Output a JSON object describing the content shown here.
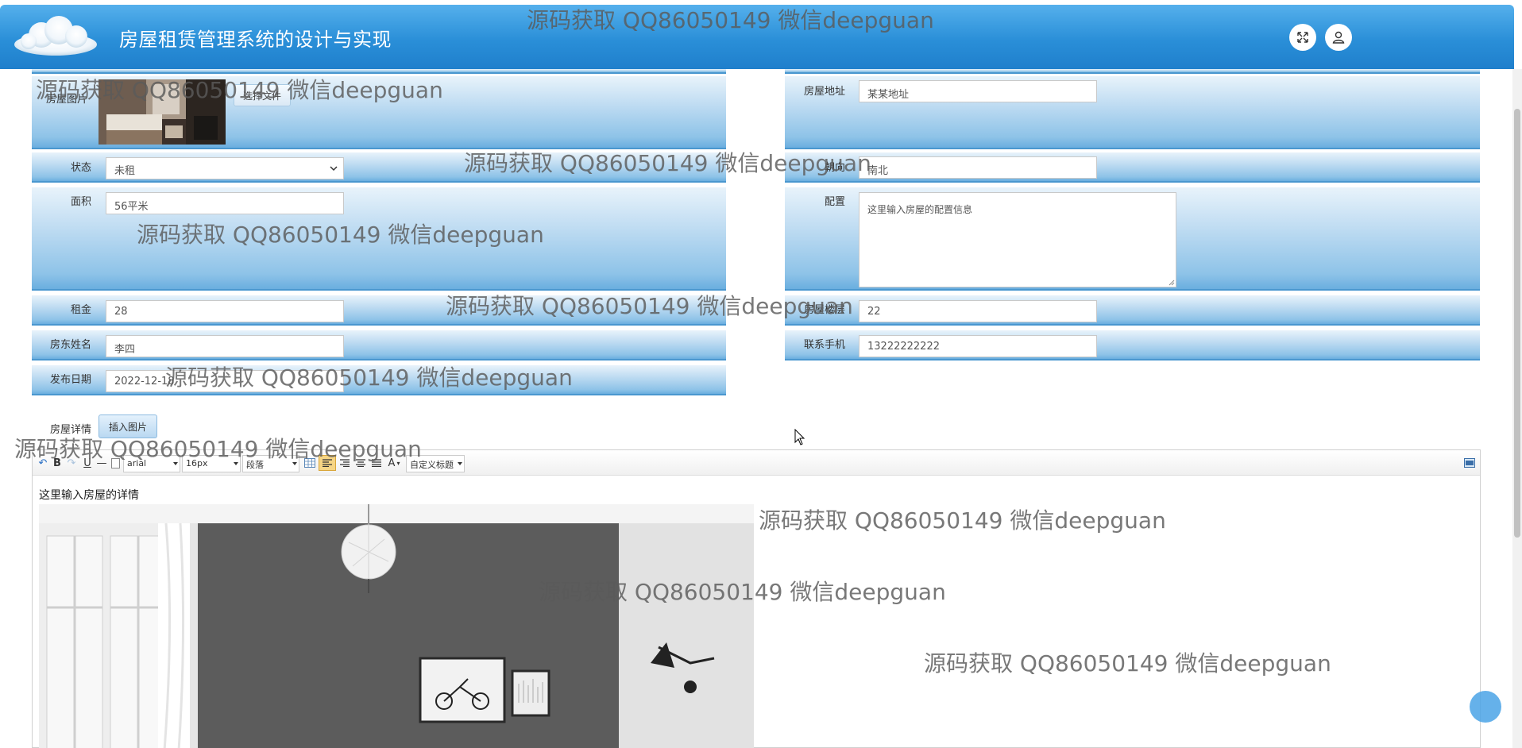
{
  "header": {
    "title": "房屋租赁管理系统的设计与实现",
    "fullscreen_icon": "fullscreen-icon",
    "user_icon": "user-icon",
    "bg_color": "#2a8fd8"
  },
  "form": {
    "photo_label": "房屋图片",
    "file_button": "选择文件",
    "address_label": "房屋地址",
    "address_value": "某某地址",
    "status_label": "状态",
    "status_value": "未租",
    "orientation_label": "朝向",
    "orientation_value": "南北",
    "area_label": "面积",
    "area_value": "56平米",
    "config_label": "配置",
    "config_value": "这里输入房屋的配置信息",
    "rent_label": "租金",
    "rent_value": "28",
    "floor_label": "房屋楼层",
    "floor_value": "22",
    "landlord_label": "房东姓名",
    "landlord_value": "李四",
    "phone_label": "联系手机",
    "phone_value": "13222222222",
    "date_label": "发布日期",
    "date_value": "2022-12-18",
    "detail_label": "房屋详情",
    "insert_image_button": "插入图片"
  },
  "editor": {
    "font_family": "arial",
    "font_size": "16px",
    "paragraph": "段落",
    "custom_title": "自定义标题",
    "bold": "B",
    "underline": "U",
    "text_color": "A",
    "content_text": "这里输入房屋的详情"
  },
  "watermark": "源码获取 QQ86050149 微信deepguan"
}
